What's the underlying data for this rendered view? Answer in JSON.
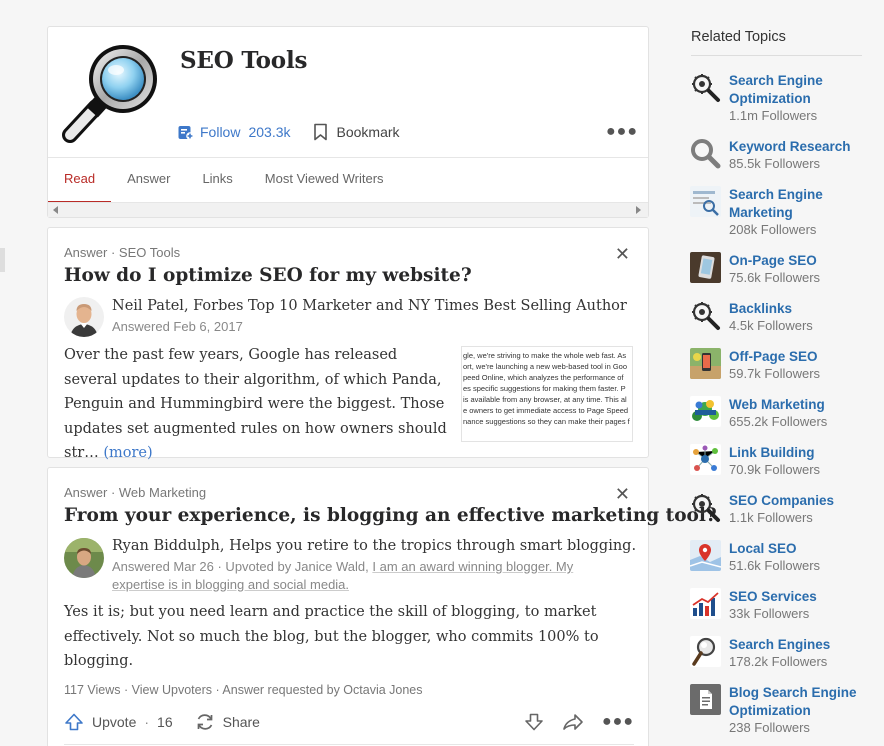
{
  "topic": {
    "title": "SEO Tools",
    "follow_label": "Follow",
    "follow_count": "203.3k",
    "bookmark_label": "Bookmark"
  },
  "tabs": [
    {
      "label": "Read",
      "active": true
    },
    {
      "label": "Answer",
      "active": false
    },
    {
      "label": "Links",
      "active": false
    },
    {
      "label": "Most Viewed Writers",
      "active": false
    }
  ],
  "answers": [
    {
      "meta": "Answer · SEO Tools",
      "question": "How do I optimize SEO for my website?",
      "author": "Neil Patel, Forbes Top 10 Marketer and NY Times Best Selling Author",
      "answered": "Answered Feb 6, 2017",
      "body": "Over the past few years, Google has released several updates to their algorithm, of which Panda, Penguin and Hummingbird were the biggest. Those updates set augmented rules on how owners should str…",
      "more_label": "(more)",
      "thumb_lines": [
        "gle, we're striving to make the whole web fast. As",
        "ort, we're launching a new web-based tool in Goo",
        "peed Online, which analyzes the performance of",
        "es specific suggestions for making them faster. P",
        "is available from any browser, at any time. This al",
        "e owners to get immediate access to Page Speed",
        "nance suggestions so they can make their pages f"
      ]
    },
    {
      "meta": "Answer · Web Marketing",
      "question": "From your experience, is blogging an effective marketing tool?",
      "author": "Ryan Biddulph, Helps you retire to the tropics through smart blogging.",
      "answered_prefix": "Answered Mar 26 · Upvoted by Janice Wald, ",
      "answered_upvoter": "I am an award winning blogger. My expertise is in blogging and social media.",
      "body": "Yes it is; but you need learn and practice the skill of blogging, to market effectively. Not so much the blog, but the blogger, who commits 100% to blogging.",
      "stats": "117 Views · View Upvoters · Answer requested by Octavia Jones",
      "upvote_label": "Upvote",
      "upvote_count": "16",
      "share_label": "Share"
    }
  ],
  "related": {
    "title": "Related Topics",
    "items": [
      {
        "name": "Search Engine Optimization",
        "followers": "1.1m Followers",
        "icon": "gear-magnifier-icon"
      },
      {
        "name": "Keyword Research",
        "followers": "85.5k Followers",
        "icon": "magnifier-icon"
      },
      {
        "name": "Search Engine Marketing",
        "followers": "208k Followers",
        "icon": "sem-icon"
      },
      {
        "name": "On-Page SEO",
        "followers": "75.6k Followers",
        "icon": "phone-icon"
      },
      {
        "name": "Backlinks",
        "followers": "4.5k Followers",
        "icon": "gear-magnifier-icon"
      },
      {
        "name": "Off-Page SEO",
        "followers": "59.7k Followers",
        "icon": "offpage-icon"
      },
      {
        "name": "Web Marketing",
        "followers": "655.2k Followers",
        "icon": "success-icon"
      },
      {
        "name": "Link Building",
        "followers": "70.9k Followers",
        "icon": "network-icon"
      },
      {
        "name": "SEO Companies",
        "followers": "1.1k Followers",
        "icon": "gear-magnifier-icon"
      },
      {
        "name": "Local SEO",
        "followers": "51.6k Followers",
        "icon": "map-pin-icon"
      },
      {
        "name": "SEO Services",
        "followers": "33k Followers",
        "icon": "bar-chart-icon"
      },
      {
        "name": "Search Engines",
        "followers": "178.2k Followers",
        "icon": "magnifier-icon"
      },
      {
        "name": "Blog Search Engine Optimization",
        "followers": "238 Followers",
        "icon": "document-icon"
      }
    ]
  },
  "colors": {
    "link": "#3e78c9",
    "topic_link": "#2b6dad",
    "active_tab": "#b92b27"
  }
}
